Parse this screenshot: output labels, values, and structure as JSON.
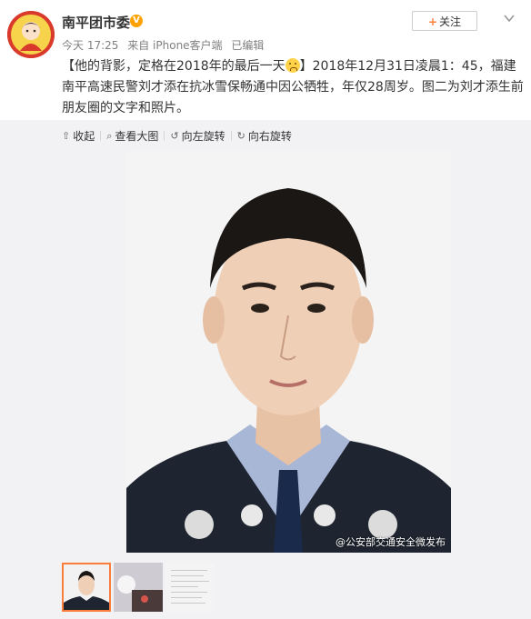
{
  "header": {
    "username": "南平团市委",
    "verified_icon": "V",
    "meta": {
      "time": "今天 17:25",
      "source": "来自 iPhone客户端",
      "edited": "已编辑"
    },
    "follow_label": "关注",
    "follow_plus": "+"
  },
  "post": {
    "text_before_emoji": "【他的背影，定格在2018年的最后一天",
    "text_after_emoji": "】2018年12月31日凌晨1：45，福建南平高速民警刘才添在抗冰雪保畅通中因公牺牲，年仅28周岁。图二为刘才添生前朋友圈的文字和照片。"
  },
  "media_actions": [
    {
      "icon": "⇧",
      "label": "收起"
    },
    {
      "icon": "⌕",
      "label": "查看大图"
    },
    {
      "icon": "↺",
      "label": "向左旋转"
    },
    {
      "icon": "↻",
      "label": "向右旋转"
    }
  ],
  "photo": {
    "watermark": "@公安部交通安全微发布"
  },
  "colors": {
    "accent": "#fa7d3c",
    "verified": "#ffa200",
    "uniform": "#1f2530",
    "shirt": "#a9b7d6"
  }
}
